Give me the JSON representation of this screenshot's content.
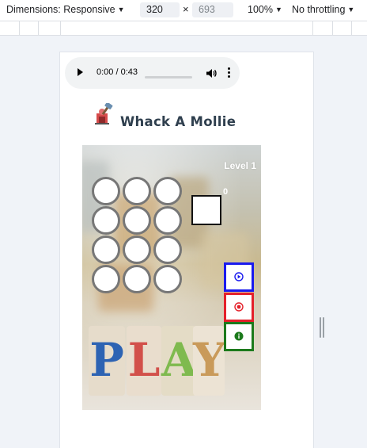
{
  "devtools": {
    "dimensions_label": "Dimensions: Responsive",
    "width_value": "320",
    "times_symbol": "×",
    "height_placeholder": "693",
    "zoom": "100%",
    "throttling": "No throttling"
  },
  "audio": {
    "time": "0:00 / 0:43",
    "progress": 0
  },
  "app": {
    "title": "Whack A Mollie"
  },
  "game": {
    "level": "Level 1",
    "score": "0",
    "grid": {
      "rows": 4,
      "cols": 3
    },
    "background_letters": [
      "P",
      "L",
      "A",
      "Y"
    ],
    "controls": [
      "play-control",
      "record-control",
      "info-control"
    ]
  },
  "colors": {
    "play_border": "#1a1aee",
    "record_border": "#e4202a",
    "info_border": "#1c7a1c"
  }
}
